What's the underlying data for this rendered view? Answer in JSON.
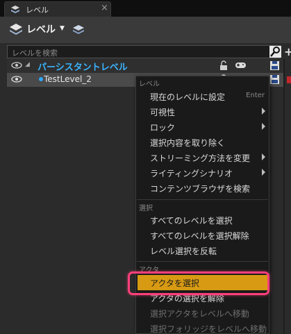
{
  "tab": {
    "title": "レベル",
    "close": "×"
  },
  "toolbar": {
    "label": "レベル",
    "caret": "▼"
  },
  "search": {
    "placeholder": "レベルを検索",
    "side_plus": "+"
  },
  "levels": {
    "persistent": {
      "name": "パーシスタントレベル",
      "expand": "◢"
    },
    "sub": {
      "name": "TestLevel_2"
    }
  },
  "menu": {
    "section_level": "レベル",
    "set_current": {
      "label": "現在のレベルに設定",
      "shortcut": "Enter"
    },
    "visibility": "可視性",
    "lock": "ロック",
    "remove_selected": "選択内容を取り除く",
    "change_streaming": "ストリーミング方法を変更",
    "lighting_scenario": "ライティングシナリオ",
    "find_in_browser": "コンテンツブラウザを検索",
    "section_select": "選択",
    "select_all": "すべてのレベルを選択",
    "deselect_all": "すべてのレベルを選択解除",
    "invert_selection": "レベル選択を反転",
    "section_actor": "アクタ",
    "select_actors": "アクタを選択",
    "deselect_actors": "アクタの選択を解除",
    "move_actors": "選択アクタをレベルへ移動",
    "move_foliage": "選択フォリッジをレベルへ移動"
  },
  "colors": {
    "highlight": "#d79a12",
    "callout": "#ff3f7a",
    "level_blue": "#3ab4ff"
  }
}
